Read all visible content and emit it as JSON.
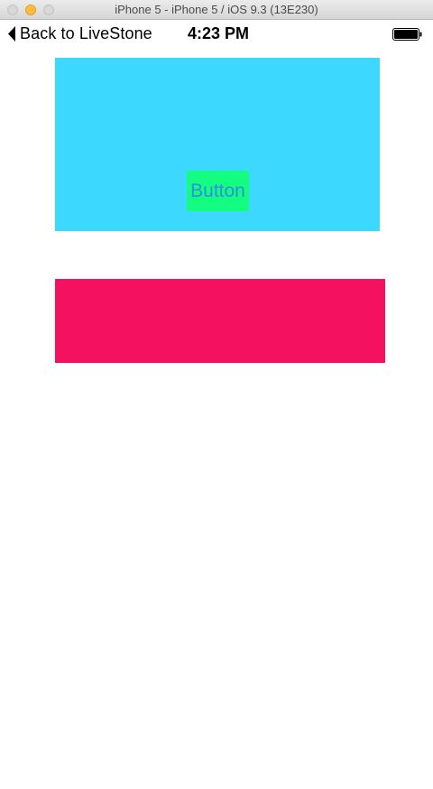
{
  "window": {
    "title": "iPhone 5 - iPhone 5 / iOS 9.3 (13E230)"
  },
  "status_bar": {
    "back_label": "Back to LiveStone",
    "time": "4:23 PM",
    "battery_level": 1.0
  },
  "button": {
    "label": "Button"
  },
  "colors": {
    "cyan_view": "#3dd8fd",
    "button_background": "#13fe80",
    "button_text": "#2e8fe2",
    "pink_view": "#f31160"
  },
  "icons": {
    "back": "chevron-left-icon",
    "battery": "battery-icon"
  }
}
